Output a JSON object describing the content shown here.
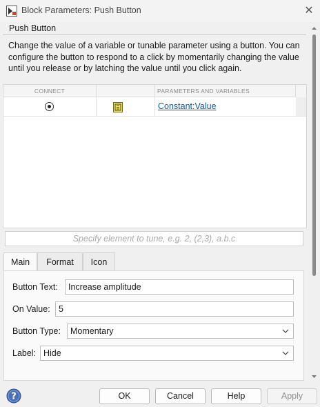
{
  "window": {
    "title": "Block Parameters: Push Button",
    "close_glyph": "✕",
    "app_icon": "simulink-block-icon"
  },
  "group": {
    "title": "Push Button",
    "description": "Change the value of a variable or tunable parameter using a button. You can configure the button to respond to a click by momentarily changing the value until you release or by latching the value until you click again."
  },
  "table": {
    "columns": {
      "connect": "CONNECT",
      "icon": "",
      "parameters": "PARAMETERS AND VARIABLES"
    },
    "rows": [
      {
        "connected": true,
        "icon": "constant-block-icon",
        "parameter": "Constant:Value"
      }
    ]
  },
  "specify": {
    "placeholder": "Specify element to tune, e.g. 2, (2,3), a.b.c"
  },
  "tabs": [
    {
      "label": "Main",
      "active": true
    },
    {
      "label": "Format",
      "active": false
    },
    {
      "label": "Icon",
      "active": false
    }
  ],
  "main": {
    "button_text": {
      "label": "Button Text:",
      "value": "Increase amplitude"
    },
    "on_value": {
      "label": "On Value:",
      "value": "5"
    },
    "button_type": {
      "label": "Button Type:",
      "value": "Momentary"
    },
    "label": {
      "label": "Label:",
      "value": "Hide"
    }
  },
  "footer": {
    "ok": "OK",
    "cancel": "Cancel",
    "help": "Help",
    "apply": "Apply",
    "apply_enabled": false,
    "help_icon": "question-mark",
    "help_icon_color": "#4a6fb5"
  },
  "colors": {
    "link": "#0b5cad",
    "window_bg": "#f0f0f0"
  }
}
